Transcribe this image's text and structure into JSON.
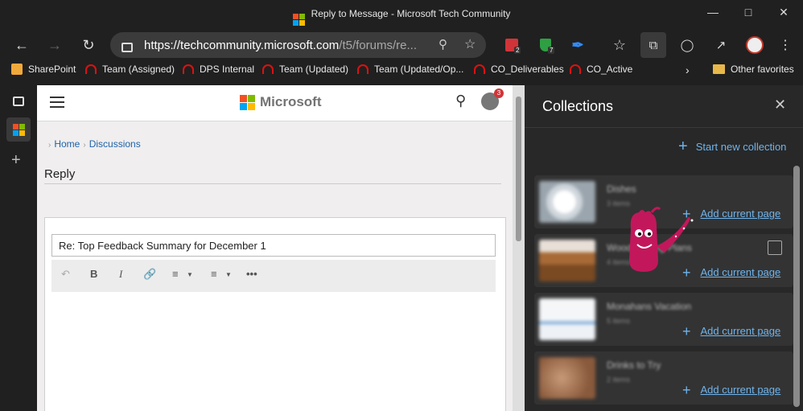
{
  "window": {
    "title": "Reply to Message - Microsoft Tech Community"
  },
  "toolbar": {
    "url_host": "https://techcommunity.microsoft.com",
    "url_path": "/t5/forums/re...",
    "badges": {
      "calendar": "2",
      "shield": "7"
    }
  },
  "favorites": [
    {
      "label": "SharePoint"
    },
    {
      "label": "Team (Assigned)"
    },
    {
      "label": "DPS Internal"
    },
    {
      "label": "Team (Updated)"
    },
    {
      "label": "Team (Updated/Op..."
    },
    {
      "label": "CO_Deliverables"
    },
    {
      "label": "CO_Active"
    },
    {
      "label": "Other favorites"
    }
  ],
  "page": {
    "brand": "Microsoft",
    "notification_count": "3",
    "breadcrumb": {
      "home": "Home",
      "discussions": "Discussions"
    },
    "reply_title": "Reply",
    "subject_value": "Re: Top Feedback Summary for December 1",
    "editor_tools": {
      "bold": "B",
      "italic": "I",
      "more": "•••"
    }
  },
  "collections": {
    "title": "Collections",
    "start_new": "Start new collection",
    "add_label": "Add current page",
    "items": [
      {
        "name": "Dishes",
        "count": "3 items"
      },
      {
        "name": "Woodworking Plans",
        "count": "4 items"
      },
      {
        "name": "Monahans Vacation",
        "count": "5 items"
      },
      {
        "name": "Drinks to Try",
        "count": "2 items"
      }
    ]
  },
  "colors": {
    "accent": "#6fb4ec",
    "chrome": "#202020",
    "panel": "#282828",
    "mascot": "#c2185b"
  }
}
